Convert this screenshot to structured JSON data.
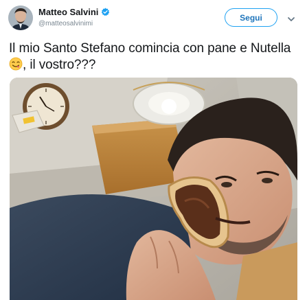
{
  "author": {
    "display_name": "Matteo Salvini",
    "handle": "@matteosalvinimi",
    "verified": true
  },
  "actions": {
    "follow_label": "Segui"
  },
  "tweet": {
    "text_before_emoji": "Il mio Santo Stefano comincia con pane e Nutella",
    "emoji": "face-savoring-food-icon",
    "text_after_emoji": ", il vostro???"
  },
  "colors": {
    "accent": "#1da1f2",
    "text": "#14171a",
    "muted": "#7a8791"
  },
  "icons": [
    "verified-badge-icon",
    "chevron-down-icon",
    "face-savoring-food-icon"
  ]
}
